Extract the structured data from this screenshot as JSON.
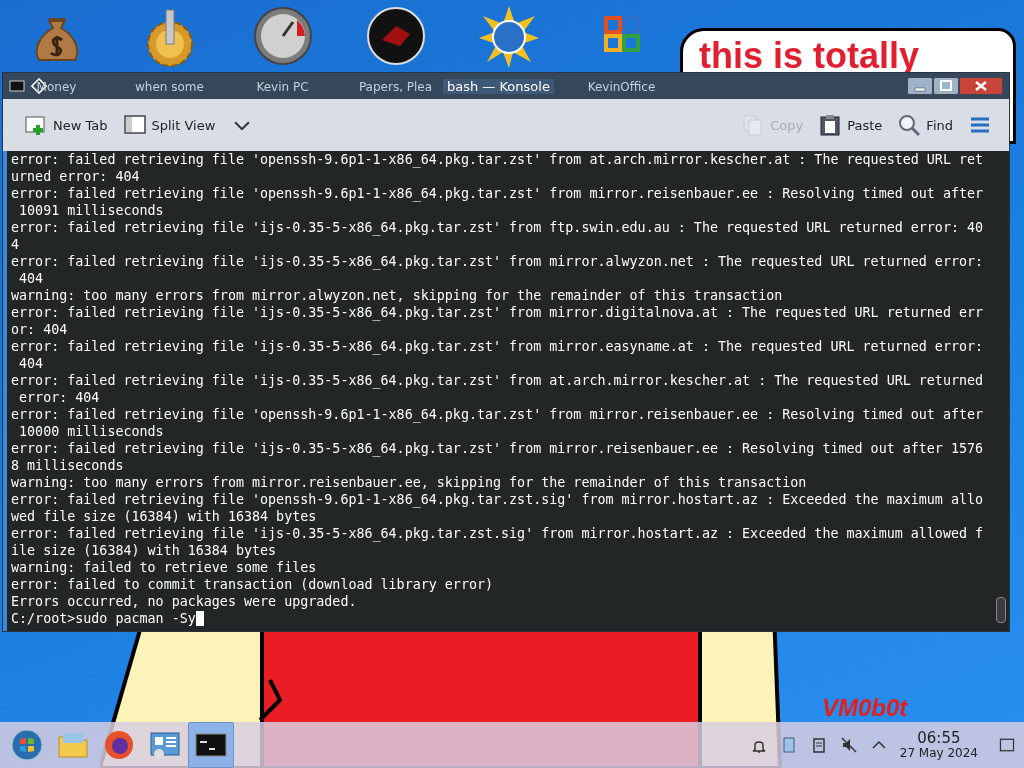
{
  "desktop": {
    "icons": [
      {
        "kind": "money-bag",
        "label": "Money"
      },
      {
        "kind": "gear",
        "label": "when some"
      },
      {
        "kind": "gauge",
        "label": "Kevin PC"
      },
      {
        "kind": "dark-disc",
        "label": "Papers, Plea"
      },
      {
        "kind": "sun-globe"
      },
      {
        "kind": "office-grid",
        "label": "KevinOffice"
      }
    ],
    "note": {
      "text": "this is totally"
    },
    "signature": "VM0b0t"
  },
  "window": {
    "title": "bash — Konsole",
    "toolbar": [
      {
        "kind": "new-tab",
        "label": "New Tab",
        "disabled": false
      },
      {
        "kind": "split-view",
        "label": "Split View",
        "disabled": false
      },
      {
        "kind": "copy",
        "label": "Copy",
        "disabled": true
      },
      {
        "kind": "paste",
        "label": "Paste",
        "disabled": false
      },
      {
        "kind": "find",
        "label": "Find",
        "disabled": false
      }
    ],
    "terminal": {
      "lines": [
        "error: failed retrieving file 'openssh-9.6p1-1-x86_64.pkg.tar.zst' from at.arch.mirror.kescher.at : The requested URL ret",
        "urned error: 404",
        "error: failed retrieving file 'openssh-9.6p1-1-x86_64.pkg.tar.zst' from mirror.reisenbauer.ee : Resolving timed out after",
        " 10091 milliseconds",
        "error: failed retrieving file 'ijs-0.35-5-x86_64.pkg.tar.zst' from ftp.swin.edu.au : The requested URL returned error: 40",
        "4",
        "error: failed retrieving file 'ijs-0.35-5-x86_64.pkg.tar.zst' from mirror.alwyzon.net : The requested URL returned error:",
        " 404",
        "warning: too many errors from mirror.alwyzon.net, skipping for the remainder of this transaction",
        "error: failed retrieving file 'ijs-0.35-5-x86_64.pkg.tar.zst' from mirror.digitalnova.at : The requested URL returned err",
        "or: 404",
        "error: failed retrieving file 'ijs-0.35-5-x86_64.pkg.tar.zst' from mirror.easyname.at : The requested URL returned error:",
        " 404",
        "error: failed retrieving file 'ijs-0.35-5-x86_64.pkg.tar.zst' from at.arch.mirror.kescher.at : The requested URL returned",
        " error: 404",
        "error: failed retrieving file 'openssh-9.6p1-1-x86_64.pkg.tar.zst' from mirror.reisenbauer.ee : Resolving timed out after",
        " 10000 milliseconds",
        "error: failed retrieving file 'ijs-0.35-5-x86_64.pkg.tar.zst' from mirror.reisenbauer.ee : Resolving timed out after 1576",
        "8 milliseconds",
        "warning: too many errors from mirror.reisenbauer.ee, skipping for the remainder of this transaction",
        "error: failed retrieving file 'openssh-9.6p1-1-x86_64.pkg.tar.zst.sig' from mirror.hostart.az : Exceeded the maximum allo",
        "wed file size (16384) with 16384 bytes",
        "error: failed retrieving file 'ijs-0.35-5-x86_64.pkg.tar.zst.sig' from mirror.hostart.az : Exceeded the maximum allowed f",
        "ile size (16384) with 16384 bytes",
        "warning: failed to retrieve some files",
        "error: failed to commit transaction (download library error)",
        "Errors occurred, no packages were upgraded."
      ],
      "prompt": "C:/root>sudo pacman -Sy"
    }
  },
  "taskbar": {
    "apps": [
      {
        "kind": "start",
        "selected": false
      },
      {
        "kind": "files",
        "selected": false
      },
      {
        "kind": "firefox",
        "selected": false
      },
      {
        "kind": "settings",
        "selected": false
      },
      {
        "kind": "konsole",
        "selected": true
      }
    ],
    "time": "06:55",
    "date": "27 May 2024"
  }
}
